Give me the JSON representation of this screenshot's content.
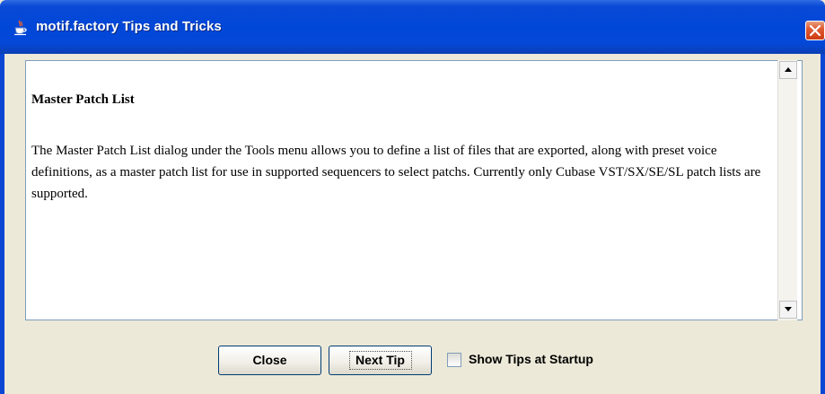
{
  "window": {
    "title": "motif.factory Tips and Tricks",
    "icon": "java-cup-icon",
    "close_icon": "close-icon"
  },
  "tip": {
    "heading": "Master Patch List",
    "body": "The Master Patch List dialog under the Tools menu allows you to define a list of files that are exported, along with preset voice definitions, as a master patch list for use in supported sequencers to select patchs. Currently only Cubase VST/SX/SE/SL patch lists are supported."
  },
  "buttons": {
    "close_label": "Close",
    "next_tip_label": "Next Tip"
  },
  "show_tips": {
    "label": "Show Tips at Startup",
    "checked": false
  },
  "colors": {
    "titlebar": "#0047d8",
    "dialog_bg": "#ece9d8",
    "close_button": "#e05a32"
  }
}
